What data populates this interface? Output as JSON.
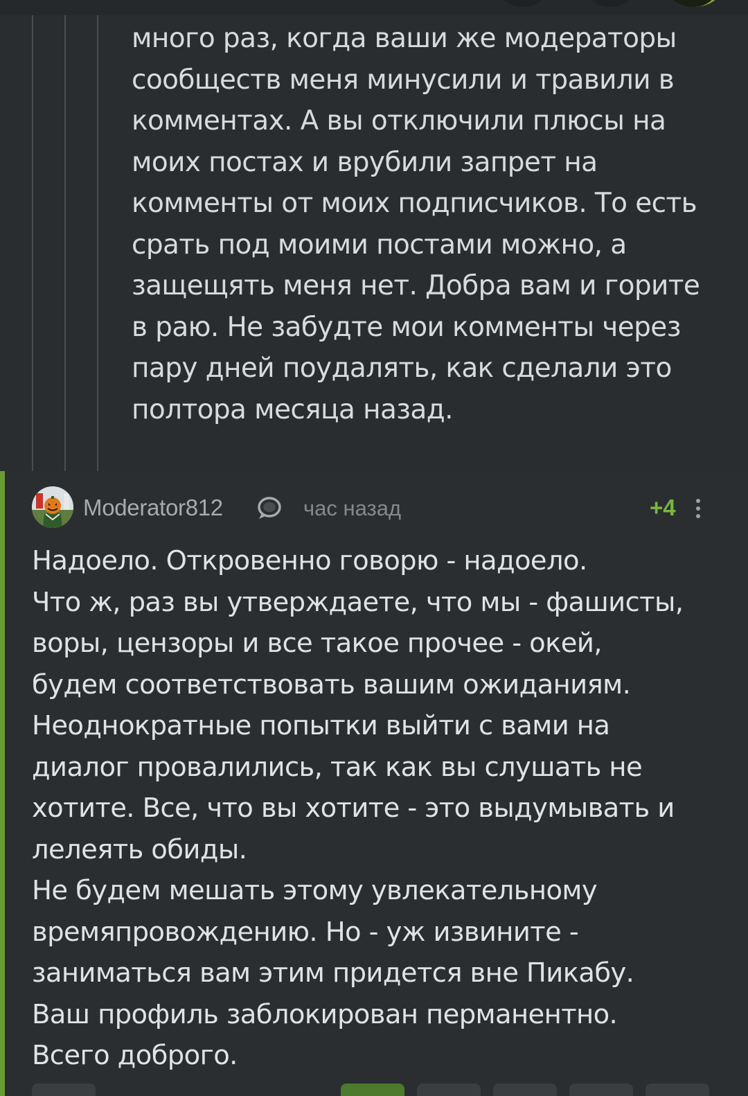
{
  "parent_comment": {
    "text": "много раз, когда ваши же модераторы\nсообществ меня минусили и травили в\nкомментах. А вы отключили плюсы на\nмоих постах и врубили запрет на\nкомменты от моих подписчиков. То есть\nсрать под моими постами можно, а\nзащещять  меня нет. Добра вам и горите\nв раю. Не забудте мои комменты через\nпару дней поудалять, как сделали это\nполтора месяца назад."
  },
  "moderator_comment": {
    "username": "Moderator812",
    "badge_icon": "moderator-badge-icon",
    "timestamp": "час назад",
    "rating": "+4",
    "more_icon": "more-vertical-icon",
    "accent_color": "#6a9c33",
    "text": "Надоело. Откровенно говорю - надоело.\nЧто ж, раз вы утверждаете, что мы - фашисты,\nворы, цензоры и все такое прочее - окей,\nбудем соответствовать вашим ожиданиям.\nНеоднократные попытки выйти с вами на\nдиалог провалились, так как вы слушать не\nхотите. Все, что вы хотите - это выдумывать и\nлелеять обиды.\nНе будем мешать этому увлекательному\nвремяпровождению. Но - уж извините -\nзаниматься вам этим придется вне Пикабу.\nВаш профиль заблокирован перманентно.\nВсего доброго."
  }
}
